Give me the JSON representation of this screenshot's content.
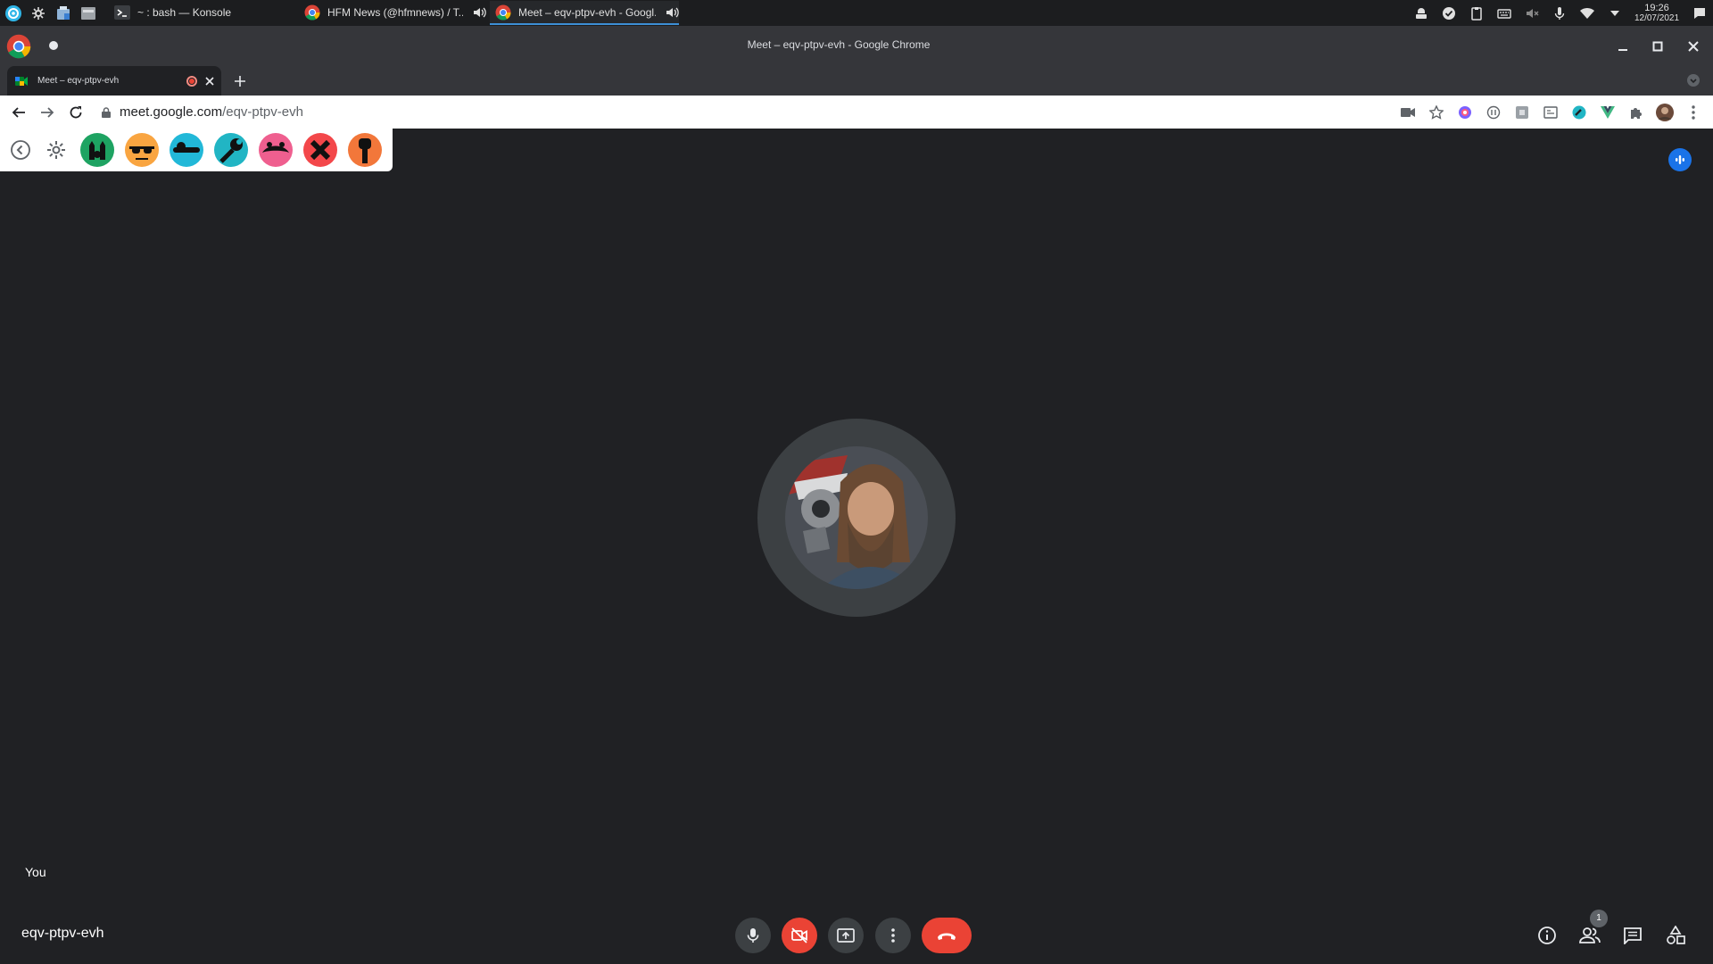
{
  "taskbar": {
    "launchers": [
      "app-launcher-icon",
      "settings-icon",
      "package-manager-icon",
      "file-manager-icon"
    ],
    "tasks": [
      {
        "label": "~ : bash — Konsole",
        "icon": "terminal-icon",
        "active": false
      },
      {
        "label": "HFM News (@hfmnews) / T...",
        "icon": "chrome-icon",
        "active": false,
        "audio": true
      },
      {
        "label": "Meet – eqv-ptpv-evh - Googl...",
        "icon": "chrome-icon",
        "active": true,
        "audio": true
      }
    ],
    "clock": {
      "time": "19:26",
      "date": "12/07/2021"
    }
  },
  "window": {
    "title": "Meet – eqv-ptpv-evh - Google Chrome"
  },
  "tab": {
    "title": "Meet – eqv-ptpv-evh",
    "recording_color": "#ea4335"
  },
  "omnibox": {
    "host": "meet.google.com",
    "path": "/eqv-ptpv-evh"
  },
  "reactions_panel": {
    "emojis": [
      {
        "name": "hands-up-emoji",
        "color": "#1ea362"
      },
      {
        "name": "sunglasses-emoji",
        "color": "#f9a541"
      },
      {
        "name": "sleeping-emoji",
        "color": "#22b8d8"
      },
      {
        "name": "wrench-emoji",
        "color": "#21b5c4"
      },
      {
        "name": "kiss-emoji",
        "color": "#ef5f8f"
      },
      {
        "name": "cross-emoji",
        "color": "#f3474a"
      },
      {
        "name": "raised-fist-emoji",
        "color": "#f2773a"
      }
    ]
  },
  "meet": {
    "self_label": "You",
    "meeting_code": "eqv-ptpv-evh",
    "people_count": "1",
    "accent": "#1a73e8",
    "danger": "#ea4335"
  }
}
